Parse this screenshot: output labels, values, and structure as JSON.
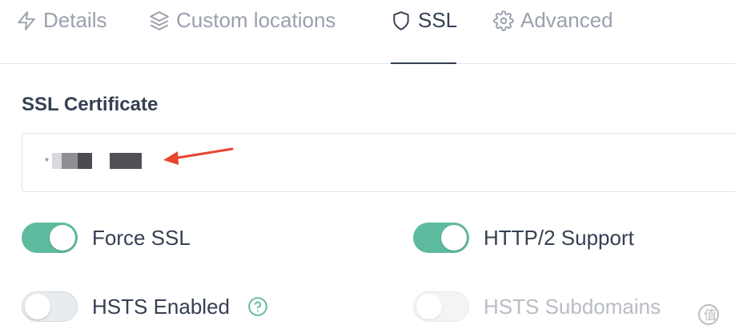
{
  "tabs": [
    {
      "label": "Details",
      "icon": "bolt-icon",
      "active": false
    },
    {
      "label": "Custom locations",
      "icon": "layers-icon",
      "active": false
    },
    {
      "label": "SSL",
      "icon": "shield-icon",
      "active": true
    },
    {
      "label": "Advanced",
      "icon": "gear-icon",
      "active": false
    }
  ],
  "ssl_certificate": {
    "label": "SSL Certificate",
    "value": "*"
  },
  "toggles": {
    "force_ssl": {
      "label": "Force SSL",
      "on": true
    },
    "http2_support": {
      "label": "HTTP/2 Support",
      "on": true
    },
    "hsts_enabled": {
      "label": "HSTS Enabled",
      "on": false
    },
    "hsts_subdomains": {
      "label": "HSTS Subdomains",
      "on": false,
      "disabled": true
    }
  },
  "colors": {
    "accent": "#5eba9e",
    "annotation_arrow": "#e8452c",
    "text": "#354052",
    "muted": "#9aa0ac"
  }
}
